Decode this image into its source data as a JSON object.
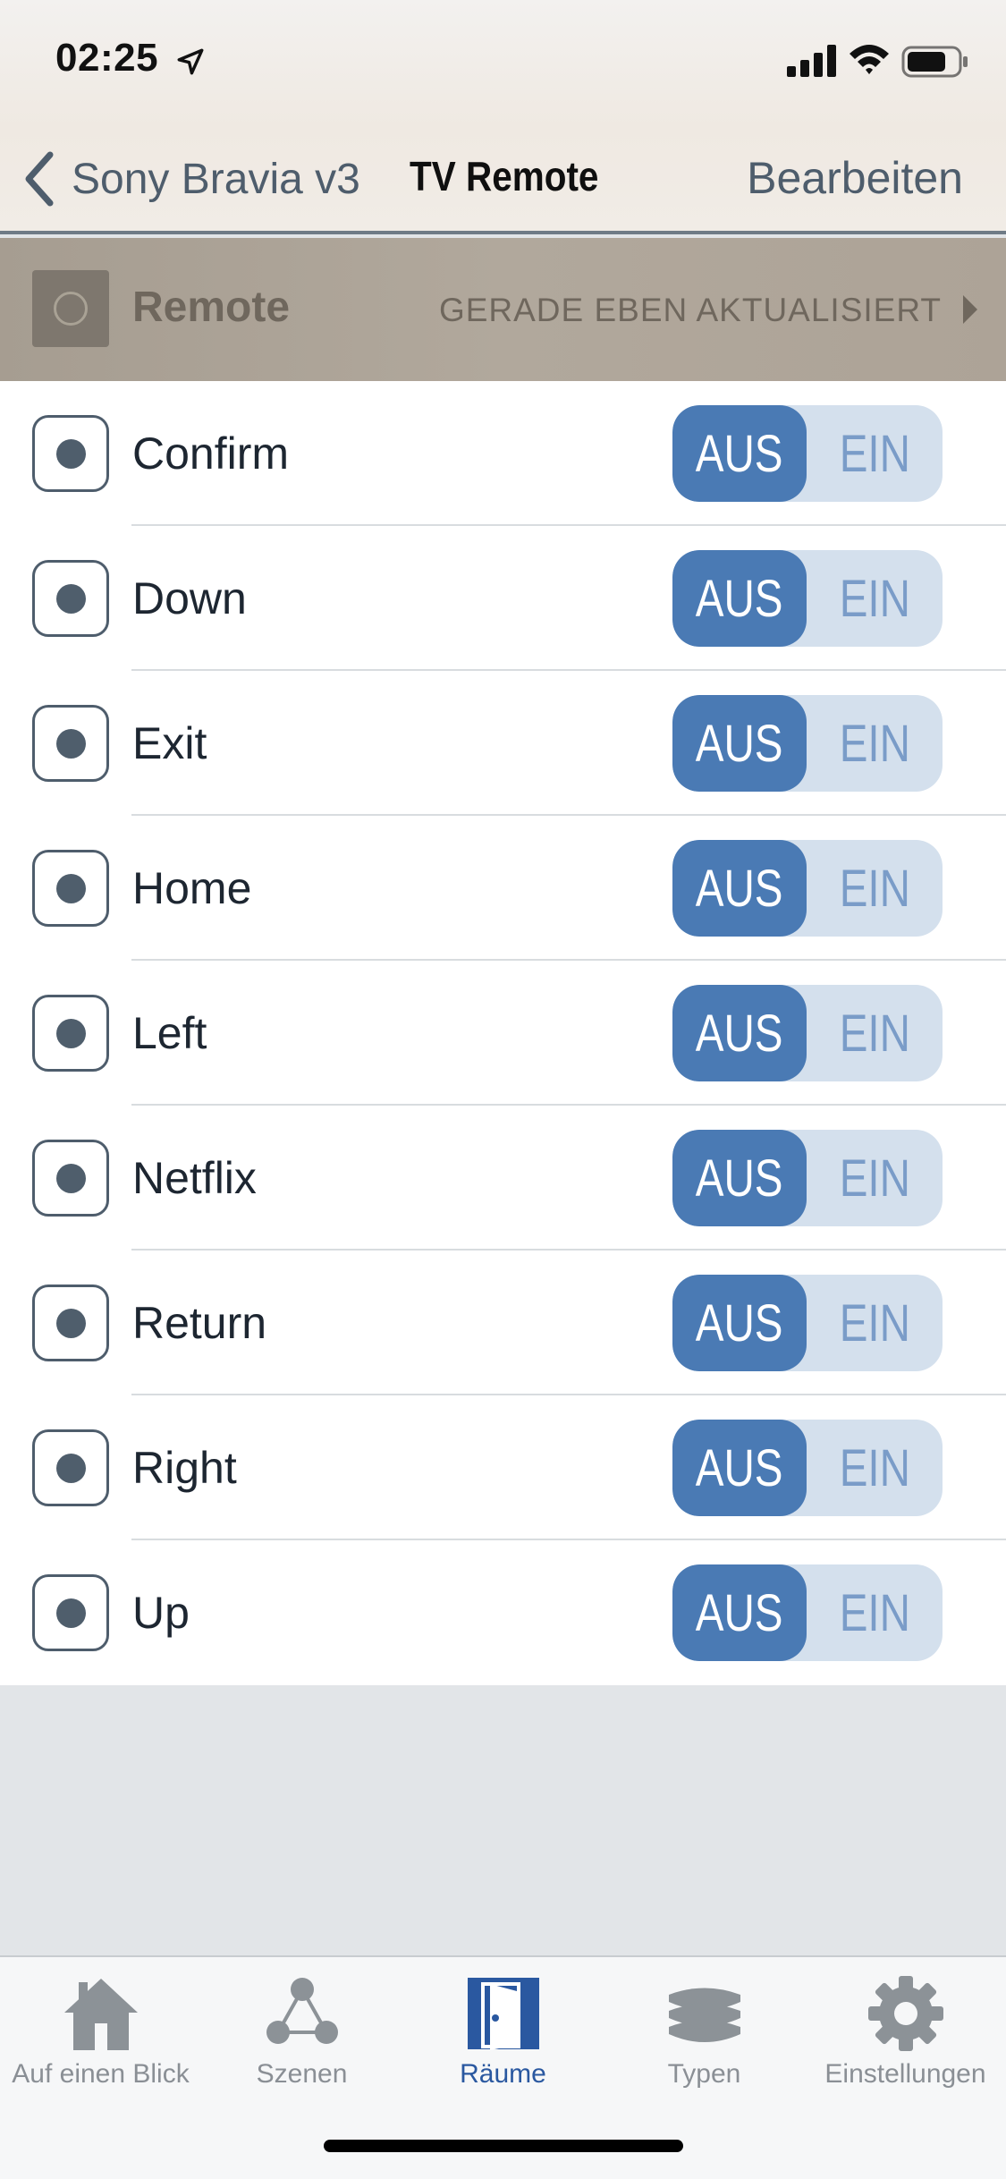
{
  "status_bar": {
    "time": "02:25"
  },
  "nav": {
    "back_label": "Sony Bravia v3",
    "title": "TV Remote",
    "edit_label": "Bearbeiten"
  },
  "section": {
    "title": "Remote",
    "status": "GERADE EBEN AKTUALISIERT"
  },
  "rows": [
    {
      "label": "Confirm",
      "off": "AUS",
      "on": "EIN"
    },
    {
      "label": "Down",
      "off": "AUS",
      "on": "EIN"
    },
    {
      "label": "Exit",
      "off": "AUS",
      "on": "EIN"
    },
    {
      "label": "Home",
      "off": "AUS",
      "on": "EIN"
    },
    {
      "label": "Left",
      "off": "AUS",
      "on": "EIN"
    },
    {
      "label": "Netflix",
      "off": "AUS",
      "on": "EIN"
    },
    {
      "label": "Return",
      "off": "AUS",
      "on": "EIN"
    },
    {
      "label": "Right",
      "off": "AUS",
      "on": "EIN"
    },
    {
      "label": "Up",
      "off": "AUS",
      "on": "EIN"
    }
  ],
  "toggle_state": "AUS",
  "tabs": [
    {
      "label": "Auf einen Blick",
      "icon": "house-icon",
      "active": false
    },
    {
      "label": "Szenen",
      "icon": "scenes-icon",
      "active": false
    },
    {
      "label": "Räume",
      "icon": "door-icon",
      "active": true
    },
    {
      "label": "Typen",
      "icon": "layers-icon",
      "active": false
    },
    {
      "label": "Einstellungen",
      "icon": "gear-icon",
      "active": false
    }
  ],
  "colors": {
    "accent": "#4a7ab4",
    "toggle_track": "#d4e0ed",
    "active_tab": "#2a58a0",
    "inactive_tab": "#8a8f95"
  }
}
